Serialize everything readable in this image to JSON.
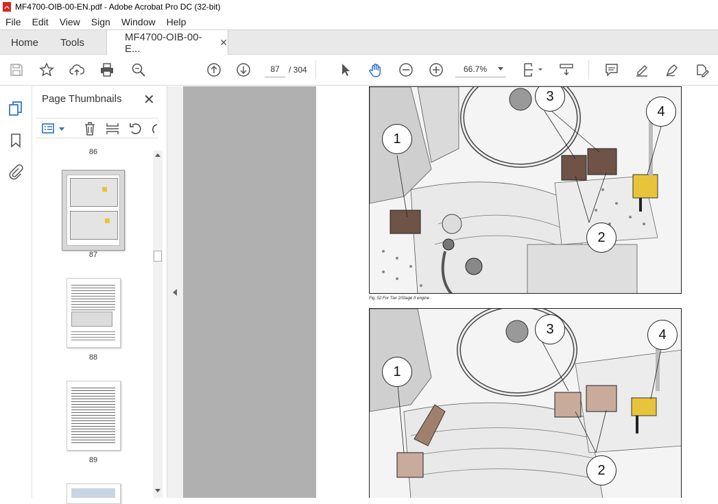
{
  "window": {
    "title": "MF4700-OIB-00-EN.pdf - Adobe Acrobat Pro DC (32-bit)"
  },
  "menu": [
    "File",
    "Edit",
    "View",
    "Sign",
    "Window",
    "Help"
  ],
  "tabs": {
    "home": "Home",
    "tools": "Tools",
    "document": "MF4700-OIB-00-E..."
  },
  "toolbar": {
    "current_page": "87",
    "page_total": "/ 304",
    "zoom": "66.7%"
  },
  "thumbnail_panel": {
    "title": "Page Thumbnails",
    "pages": [
      "86",
      "87",
      "88",
      "89"
    ],
    "selected_page": "87"
  },
  "document": {
    "figure1_caption": "Fig. 52  For Tier 2/Stage II engine",
    "figure1_callouts": [
      "1",
      "2",
      "3",
      "4"
    ],
    "figure2_callouts": [
      "1",
      "2",
      "3",
      "4"
    ]
  },
  "colors": {
    "accent": "#2a6fc7",
    "pdf_red": "#d9251c",
    "toolbar_icon": "#555555",
    "viewer_bg": "#b0b0b0",
    "pedal_brown": "#6e5346",
    "yellow_pedal": "#e8c43a"
  }
}
